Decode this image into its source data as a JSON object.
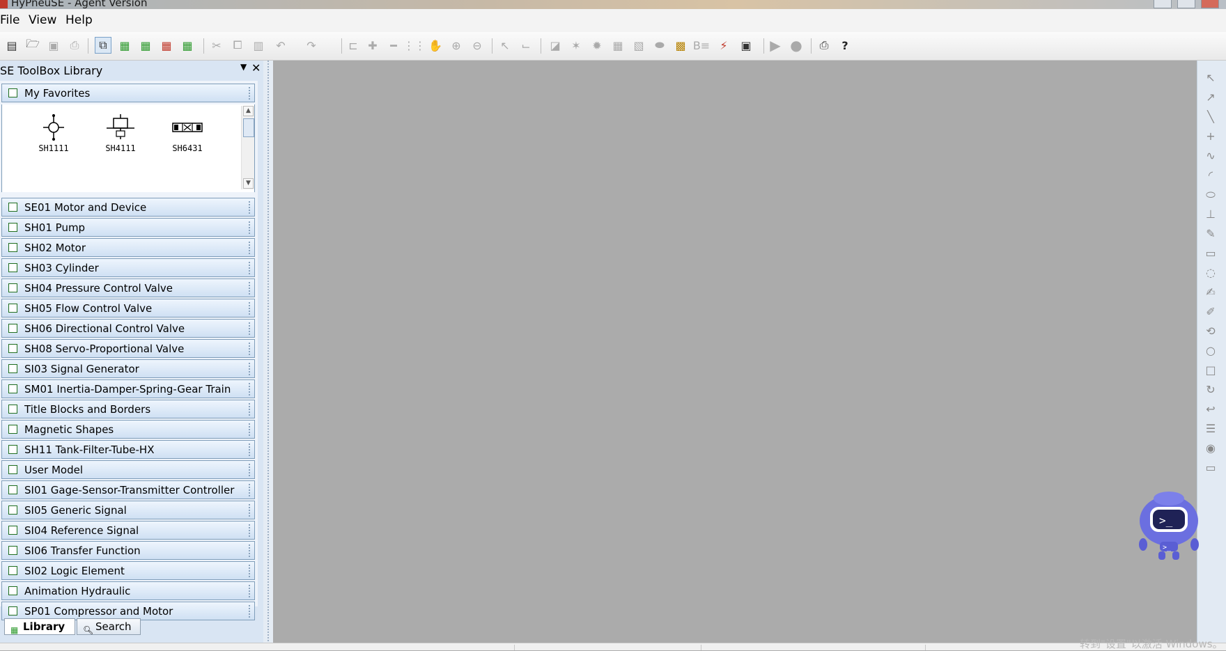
{
  "window": {
    "title": "HyPneuSE - Agent Version"
  },
  "menu": [
    "File",
    "View",
    "Help"
  ],
  "toolbar": {
    "icons": [
      "new-document-icon",
      "open-folder-icon",
      "save-icon",
      "print-icon",
      "window-icon",
      "library-add-icon",
      "library-open-icon",
      "library-delete-icon",
      "library-save-icon",
      "cut-icon",
      "copy-icon",
      "paste-icon",
      "undo-icon",
      "redo-icon",
      "align-icon",
      "plus-icon",
      "minus-icon",
      "grid-icon",
      "hand-icon",
      "zoom-in-icon",
      "zoom-out-icon",
      "pointer-icon",
      "connect-icon",
      "frame-icon",
      "component-icon",
      "gear-icon",
      "table-icon",
      "report-icon",
      "shape-icon",
      "box-icon",
      "text-icon",
      "graph-icon",
      "monitor-icon",
      "run-icon",
      "stop-icon",
      "printer-setup-icon",
      "help-icon"
    ]
  },
  "panel": {
    "title": "SE ToolBox Library",
    "favorites_label": "My Favorites",
    "favorites": [
      "SH1111",
      "SH4111",
      "SH6431"
    ],
    "sections": [
      "SE01 Motor and Device",
      "SH01 Pump",
      "SH02 Motor",
      "SH03 Cylinder",
      "SH04 Pressure Control Valve",
      "SH05 Flow Control Valve",
      "SH06 Directional Control Valve",
      "SH08 Servo-Proportional Valve",
      "SI03 Signal Generator",
      "SM01 Inertia-Damper-Spring-Gear Train",
      "Title Blocks and Borders",
      "Magnetic Shapes",
      "SH11 Tank-Filter-Tube-HX",
      "User Model",
      "SI01 Gage-Sensor-Transmitter Controller",
      "SI05 Generic Signal",
      "SI04 Reference Signal",
      "SI06 Transfer Function",
      "SI02 Logic Element",
      "Animation Hydraulic",
      "SP01 Compressor and Motor"
    ],
    "tabs": {
      "library": "Library",
      "search": "Search"
    }
  },
  "watermark": "转到\"设置\"以激活 Windows。"
}
